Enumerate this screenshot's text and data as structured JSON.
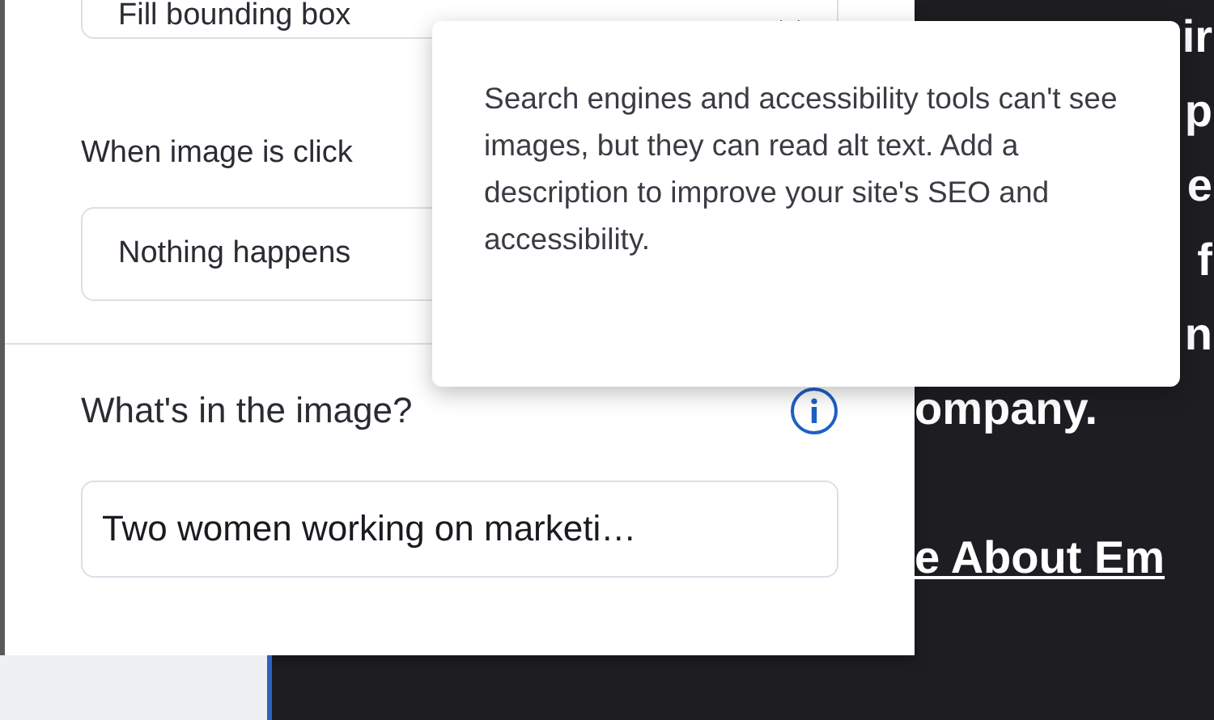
{
  "panel": {
    "fit_dropdown": {
      "value": "Fill bounding box"
    },
    "click_label": "When image is click",
    "click_dropdown": {
      "value": "Nothing happens"
    },
    "alt_label": "What's in the image?",
    "alt_field": {
      "value": "Two women working on marketi…"
    }
  },
  "tooltip": {
    "text": "Search engines and accessibility tools can't see images, but they can read alt text. Add a description to improve your site's SEO and accessibility."
  },
  "page_text": [
    {
      "text": "ir",
      "kind": "edge"
    },
    {
      "text": "p",
      "kind": "edge"
    },
    {
      "text": "e",
      "kind": "edge"
    },
    {
      "text": "f",
      "kind": "edge"
    },
    {
      "text": "n",
      "kind": "edge"
    },
    {
      "text": "ompany.",
      "kind": "line"
    },
    {
      "kind": "gap"
    },
    {
      "text": "e About Em",
      "kind": "link"
    }
  ]
}
